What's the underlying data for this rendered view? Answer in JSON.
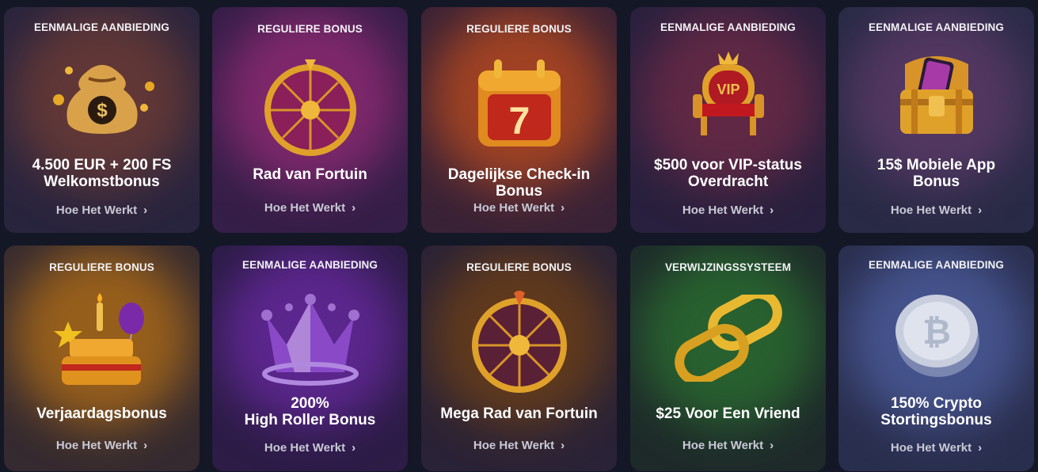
{
  "cards": [
    {
      "kicker": "EENMALIGE AANBIEDING",
      "title": "4.500 EUR + 200 FS\nWelkomstbonus",
      "link": "Hoe Het Werkt",
      "icon": "money-bag-icon",
      "bg": "#2a2440",
      "glow": "#6a3a3a"
    },
    {
      "kicker": "REGULIERE BONUS",
      "title": "Rad van Fortuin",
      "link": "Hoe Het Werkt",
      "icon": "fortune-wheel-icon",
      "bg": "#3a1f4a",
      "glow": "#9a2c7a"
    },
    {
      "kicker": "REGULIERE BONUS",
      "title": "Dagelijkse Check-in Bonus",
      "link": "Hoe Het Werkt",
      "icon": "calendar-icon",
      "bg": "#3a2238",
      "glow": "#b44a1f"
    },
    {
      "kicker": "EENMALIGE AANBIEDING",
      "title": "$500 voor VIP-status\nOverdracht",
      "link": "Hoe Het Werkt",
      "icon": "vip-throne-icon",
      "bg": "#2a2040",
      "glow": "#6a2a4a"
    },
    {
      "kicker": "EENMALIGE AANBIEDING",
      "title": "15$ Mobiele App\nBonus",
      "link": "Hoe Het Werkt",
      "icon": "treasure-chest-icon",
      "bg": "#2a2a48",
      "glow": "#5a3a6a"
    },
    {
      "kicker": "REGULIERE BONUS",
      "title": "Verjaardagsbonus",
      "link": "Hoe Het Werkt",
      "icon": "birthday-cake-icon",
      "bg": "#3a2a30",
      "glow": "#b07018"
    },
    {
      "kicker": "EENMALIGE AANBIEDING",
      "title": "200%\nHigh Roller Bonus",
      "link": "Hoe Het Werkt",
      "icon": "crown-icon",
      "bg": "#2e1e48",
      "glow": "#6a2a9a"
    },
    {
      "kicker": "REGULIERE BONUS",
      "title": "Mega Rad van Fortuin",
      "link": "Hoe Het Werkt",
      "icon": "mega-wheel-icon",
      "bg": "#2a2238",
      "glow": "#6a4018"
    },
    {
      "kicker": "VERWIJZINGSSYSTEEM",
      "title": "$25 Voor Een Vriend",
      "link": "Hoe Het Werkt",
      "icon": "chain-link-icon",
      "bg": "#1e2a2a",
      "glow": "#2a6a30"
    },
    {
      "kicker": "EENMALIGE AANBIEDING",
      "title": "150% Crypto\nStortingsbonus",
      "link": "Hoe Het Werkt",
      "icon": "bitcoin-coin-icon",
      "bg": "#2a2e50",
      "glow": "#4a5a9a"
    }
  ]
}
